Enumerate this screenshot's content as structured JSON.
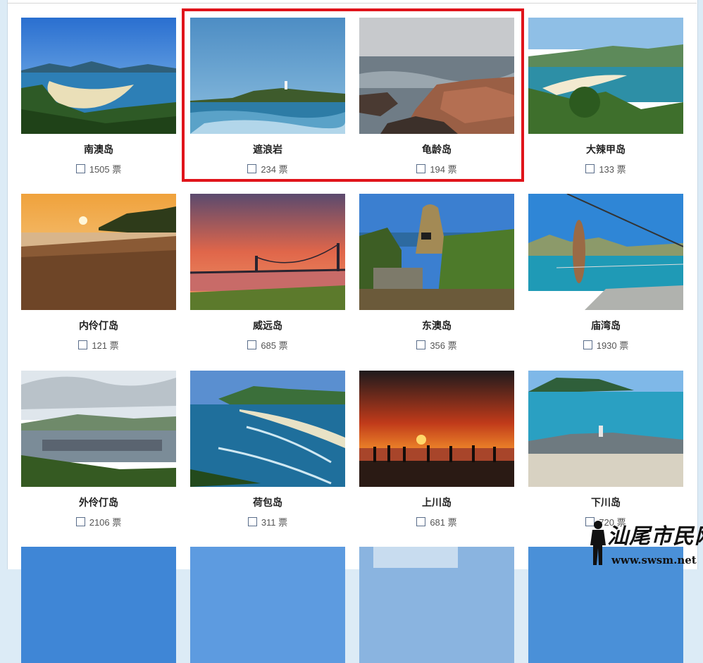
{
  "islands": [
    {
      "name": "南澳岛",
      "votes": "1505",
      "unit": "票",
      "scene": "bay"
    },
    {
      "name": "遮浪岩",
      "votes": "234",
      "unit": "票",
      "scene": "lighthouse"
    },
    {
      "name": "龟龄岛",
      "votes": "194",
      "unit": "票",
      "scene": "rocks"
    },
    {
      "name": "大辣甲岛",
      "votes": "133",
      "unit": "票",
      "scene": "green-bay"
    },
    {
      "name": "内伶仃岛",
      "votes": "121",
      "unit": "票",
      "scene": "sunset-beach"
    },
    {
      "name": "威远岛",
      "votes": "685",
      "unit": "票",
      "scene": "bridge"
    },
    {
      "name": "东澳岛",
      "votes": "356",
      "unit": "票",
      "scene": "monument"
    },
    {
      "name": "庙湾岛",
      "votes": "1930",
      "unit": "票",
      "scene": "fish"
    },
    {
      "name": "外伶仃岛",
      "votes": "2106",
      "unit": "票",
      "scene": "harbor"
    },
    {
      "name": "荷包岛",
      "votes": "311",
      "unit": "票",
      "scene": "coast"
    },
    {
      "name": "上川岛",
      "votes": "681",
      "unit": "票",
      "scene": "silhouette"
    },
    {
      "name": "下川岛",
      "votes": "720",
      "unit": "票",
      "scene": "statue"
    }
  ],
  "watermark": {
    "text": "汕尾市民网",
    "url": "www.swsm.net"
  },
  "colors": {
    "highlight": "#e0141b",
    "background": "#dcebf6"
  }
}
